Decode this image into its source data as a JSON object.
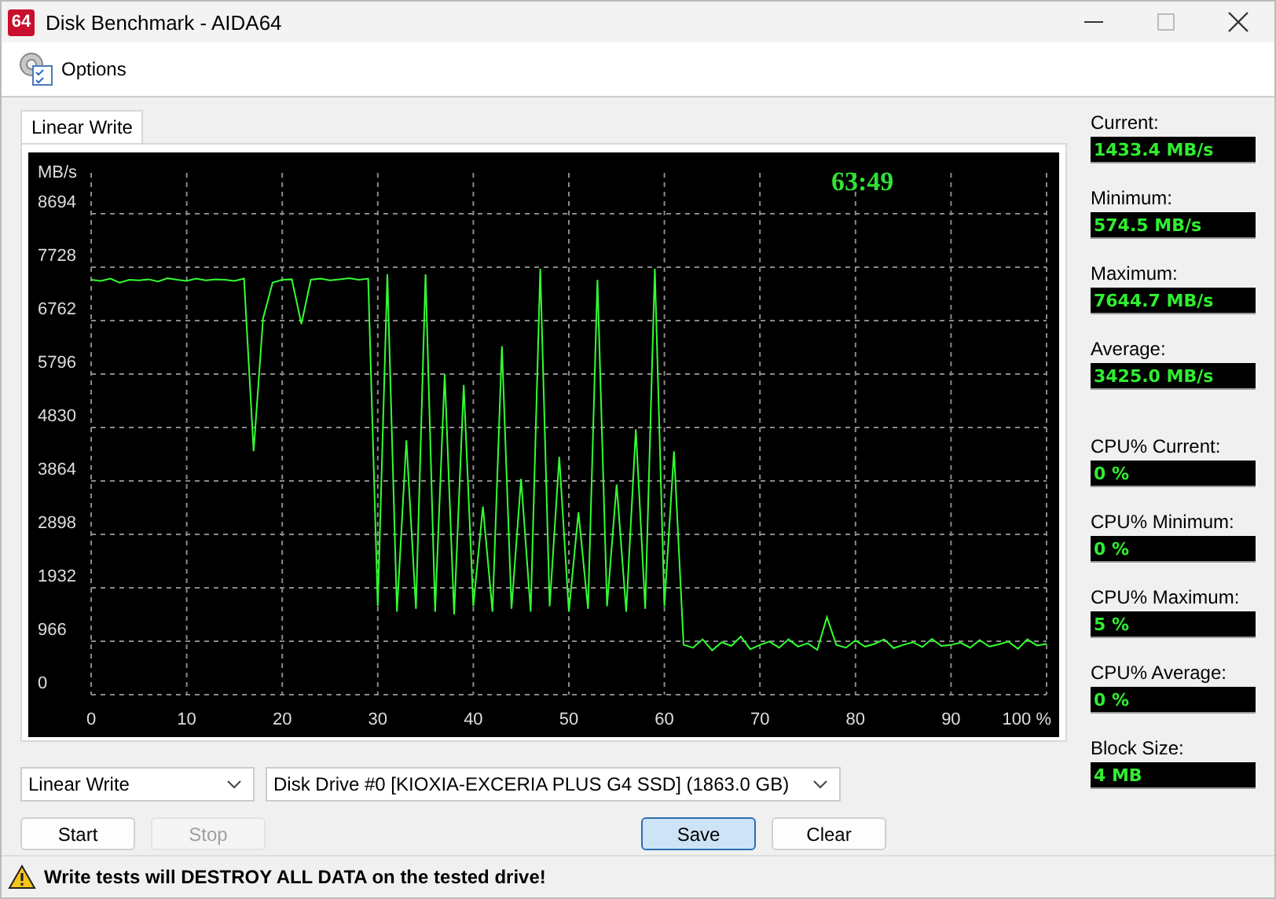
{
  "window": {
    "icon_text": "64",
    "title": "Disk Benchmark - AIDA64"
  },
  "menu": [
    {
      "label": "Options"
    }
  ],
  "tabs": [
    {
      "label": "Linear Write",
      "selected": true
    }
  ],
  "chart": {
    "timer": "63:49",
    "chart_data": {
      "type": "line",
      "ylabel": "MB/s",
      "grid": true,
      "xlim": [
        0,
        100
      ],
      "ylim": [
        0,
        8694
      ],
      "x": [
        0,
        1,
        2,
        3,
        4,
        5,
        6,
        7,
        8,
        9,
        10,
        11,
        12,
        13,
        14,
        15,
        16,
        17,
        18,
        19,
        20,
        21,
        22,
        23,
        24,
        25,
        26,
        27,
        28,
        29,
        30,
        31,
        32,
        33,
        34,
        35,
        36,
        37,
        38,
        39,
        40,
        41,
        42,
        43,
        44,
        45,
        46,
        47,
        48,
        49,
        50,
        51,
        52,
        53,
        54,
        55,
        56,
        57,
        58,
        59,
        60,
        61,
        62,
        63,
        64,
        65,
        66,
        67,
        68,
        69,
        70,
        71,
        72,
        73,
        74,
        75,
        76,
        77,
        78,
        79,
        80,
        81,
        82,
        83,
        84,
        85,
        86,
        87,
        88,
        89,
        90,
        91,
        92,
        93,
        94,
        95,
        96,
        97,
        98,
        99,
        100
      ],
      "yticks": [
        0,
        966,
        1932,
        2898,
        3864,
        4830,
        5796,
        6762,
        7728,
        8694
      ],
      "xticks": [
        0,
        10,
        20,
        30,
        40,
        50,
        60,
        70,
        80,
        90,
        {
          "value": 100,
          "label": "100 %"
        }
      ],
      "series": [
        {
          "color": "#33ff33",
          "values": [
            7500,
            7480,
            7520,
            7450,
            7500,
            7490,
            7510,
            7470,
            7530,
            7500,
            7480,
            7520,
            7490,
            7510,
            7500,
            7480,
            7520,
            4400,
            6800,
            7450,
            7500,
            7510,
            6700,
            7500,
            7520,
            7490,
            7510,
            7530,
            7500,
            7520,
            1600,
            7600,
            1500,
            4600,
            1550,
            7600,
            1500,
            5800,
            1450,
            5600,
            1600,
            3400,
            1500,
            6300,
            1550,
            3900,
            1500,
            7700,
            1600,
            4300,
            1500,
            3300,
            1550,
            7500,
            1600,
            3800,
            1500,
            4800,
            1550,
            7700,
            1600,
            4400,
            900,
            850,
            1000,
            800,
            950,
            880,
            1050,
            820,
            900,
            960,
            850,
            1000,
            870,
            930,
            810,
            1400,
            900,
            850,
            980,
            870,
            920,
            1000,
            840,
            900,
            950,
            860,
            1010,
            880,
            900,
            940,
            850,
            990,
            870,
            910,
            960,
            830,
            1000,
            890,
            920
          ]
        }
      ]
    }
  },
  "stat_groups": [
    [
      {
        "label": "Current:",
        "value": "1433.4 MB/s"
      },
      {
        "label": "Minimum:",
        "value": "574.5 MB/s"
      },
      {
        "label": "Maximum:",
        "value": "7644.7 MB/s"
      },
      {
        "label": "Average:",
        "value": "3425.0 MB/s"
      }
    ],
    [
      {
        "label": "CPU% Current:",
        "value": "0 %"
      },
      {
        "label": "CPU% Minimum:",
        "value": "0 %"
      },
      {
        "label": "CPU% Maximum:",
        "value": "5 %"
      },
      {
        "label": "CPU% Average:",
        "value": "0 %"
      },
      {
        "label": "Block Size:",
        "value": "4 MB"
      }
    ]
  ],
  "dropdowns": [
    {
      "value": "Linear Write"
    },
    {
      "value": "Disk Drive #0  [KIOXIA-EXCERIA PLUS G4 SSD]  (1863.0 GB)"
    }
  ],
  "buttons": [
    {
      "label": "Start",
      "disabled": false,
      "focused": false
    },
    {
      "label": "Stop",
      "disabled": true,
      "focused": false
    },
    {
      "label": "Save",
      "disabled": false,
      "focused": true
    },
    {
      "label": "Clear",
      "disabled": false,
      "focused": false
    }
  ],
  "status_bar": {
    "warning": "Write tests will DESTROY ALL DATA on the tested drive!"
  }
}
